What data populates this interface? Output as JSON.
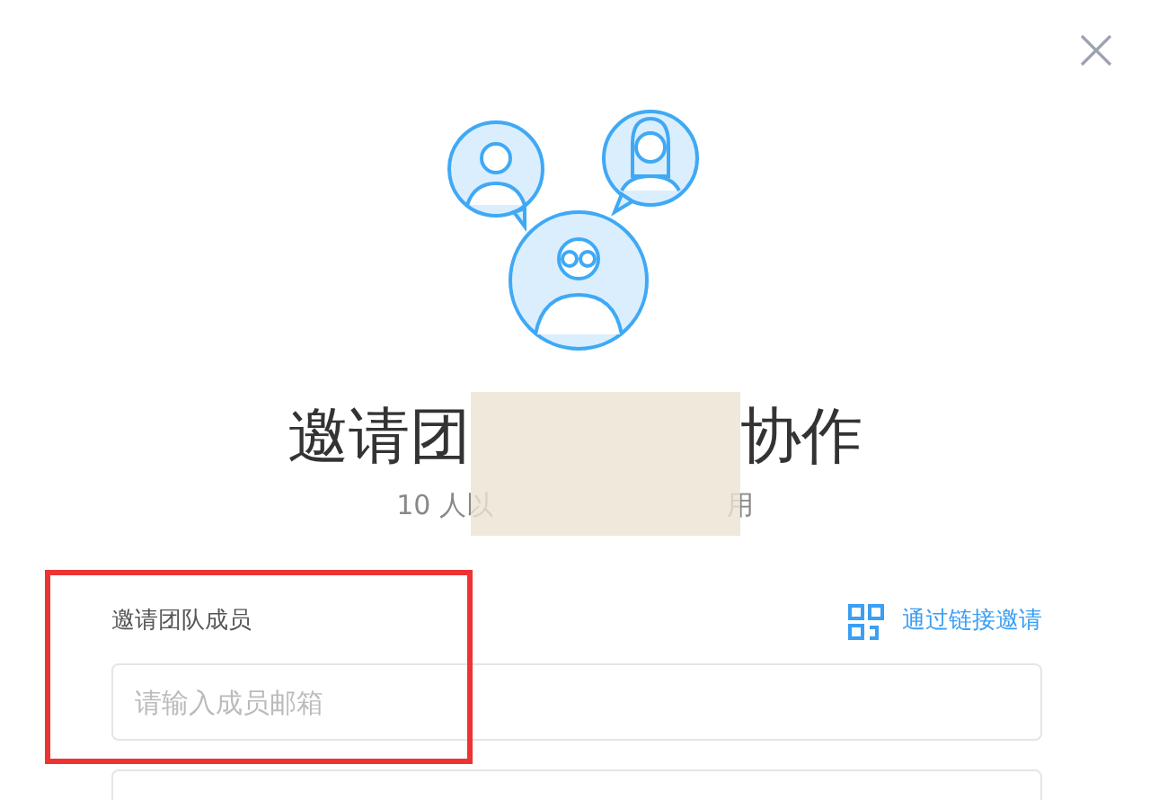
{
  "dialog": {
    "title_parts": [
      "邀请团",
      "协作"
    ],
    "subtitle_parts": [
      "10 人以",
      "用"
    ],
    "invite_label": "邀请团队成员",
    "link_invite": "通过链接邀请",
    "email_field": {
      "placeholder": "请输入成员邮箱"
    }
  }
}
